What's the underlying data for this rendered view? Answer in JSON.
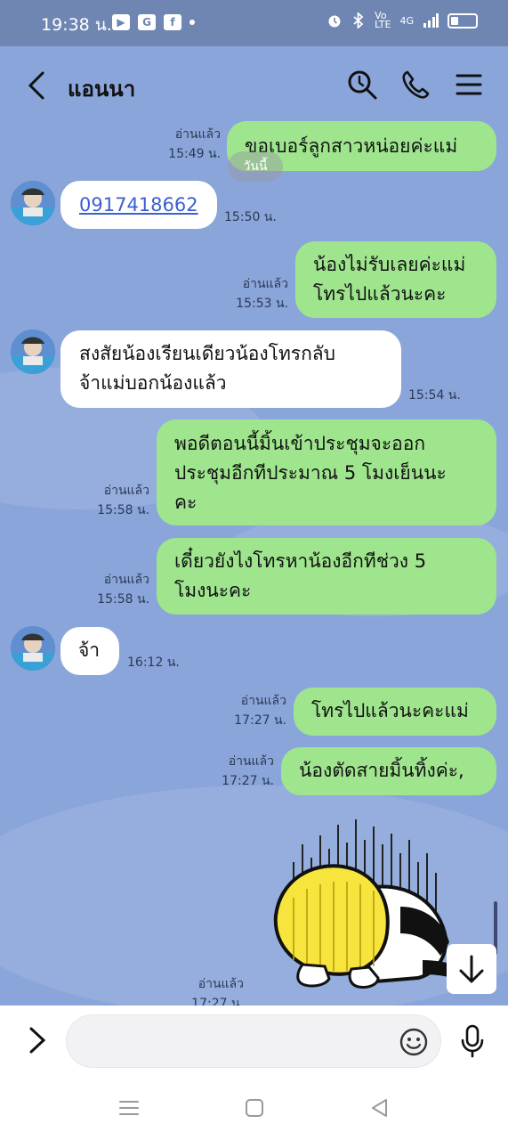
{
  "status_bar": {
    "time": "19:38 น.",
    "network": "4G"
  },
  "header": {
    "title": "แอนนา"
  },
  "date_chip": "วันนี้",
  "messages": [
    {
      "side": "out",
      "read": "อ่านแล้ว",
      "time": "15:49 น.",
      "lines": [
        "ขอเบอร์ลูกสาวหน่อยค่ะแม่"
      ]
    },
    {
      "side": "in",
      "time": "15:50 น.",
      "lines": [
        "0917418662"
      ]
    },
    {
      "side": "out",
      "read": "อ่านแล้ว",
      "time": "15:53 น.",
      "lines": [
        "น้องไม่รับเลยค่ะแม่",
        "โทรไปแล้วนะคะ"
      ]
    },
    {
      "side": "in",
      "time": "15:54 น.",
      "lines": [
        "สงสัยน้องเรียนเดียวน้องโทรกลับ",
        "จ้าแม่บอกน้องแล้ว"
      ]
    },
    {
      "side": "out",
      "read": "อ่านแล้ว",
      "time": "15:58 น.",
      "lines": [
        "พอดีตอนนี้มิ้นเข้าประชุมจะออก",
        "ประชุมอีกทีประมาณ 5 โมงเย็นนะ",
        "คะ"
      ]
    },
    {
      "side": "out",
      "read": "อ่านแล้ว",
      "time": "15:58 น.",
      "lines": [
        "เดี๋ยวยังไงโทรหาน้องอีกทีช่วง 5",
        "โมงนะคะ"
      ]
    },
    {
      "side": "in",
      "time": "16:12 น.",
      "lines": [
        "จ้า"
      ]
    },
    {
      "side": "out",
      "read": "อ่านแล้ว",
      "time": "17:27 น.",
      "lines": [
        "โทรไปแล้วนะคะแม่"
      ]
    },
    {
      "side": "out",
      "read": "อ่านแล้ว",
      "time": "17:27 น.",
      "lines": [
        "น้องตัดสายมิ้นทิ้งค่ะ,"
      ]
    },
    {
      "side": "out",
      "read": "อ่านแล้ว",
      "time": "17:27 น.",
      "sticker": "bowing-character-sticker"
    }
  ],
  "input": {
    "placeholder": "",
    "value": ""
  },
  "icons": {
    "back": "chevron-left-icon",
    "search": "search-icon",
    "call": "phone-icon",
    "menu": "menu-icon",
    "expand": "chevron-right-icon",
    "emoji": "emoji-icon",
    "mic": "microphone-icon",
    "scroll_down": "arrow-down-icon"
  },
  "colors": {
    "chat_background": "#8aa5da",
    "status_bar": "#6f86b3",
    "outgoing_bubble": "#9fe58e",
    "incoming_bubble": "#ffffff",
    "link": "#3c5fd2"
  }
}
